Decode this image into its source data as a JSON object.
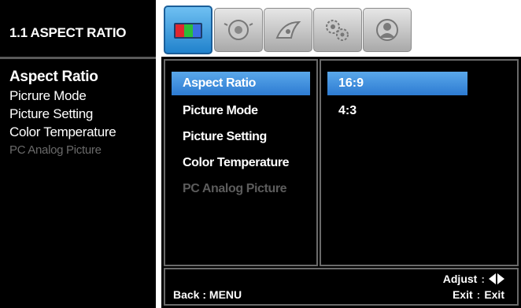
{
  "left_panel": {
    "title": "1.1 ASPECT RATIO",
    "items": [
      {
        "label": "Aspect Ratio",
        "state": "selected"
      },
      {
        "label": "Picrure Mode",
        "state": "normal"
      },
      {
        "label": "Picture Setting",
        "state": "normal"
      },
      {
        "label": "Color Temperature",
        "state": "normal"
      },
      {
        "label": "PC Analog Picture",
        "state": "disabled"
      }
    ]
  },
  "tabs": [
    {
      "icon": "picture-icon",
      "active": true
    },
    {
      "icon": "sound-icon",
      "active": false
    },
    {
      "icon": "function-icon",
      "active": false
    },
    {
      "icon": "setup-icon",
      "active": false
    },
    {
      "icon": "user-icon",
      "active": false
    }
  ],
  "menu": {
    "items": [
      {
        "label": "Aspect Ratio",
        "state": "selected"
      },
      {
        "label": "Picture Mode",
        "state": "normal"
      },
      {
        "label": "Picture Setting",
        "state": "normal"
      },
      {
        "label": "Color Temperature",
        "state": "normal"
      },
      {
        "label": "PC Analog Picture",
        "state": "disabled"
      }
    ]
  },
  "options": {
    "items": [
      {
        "label": "16:9",
        "state": "selected"
      },
      {
        "label": "4:3",
        "state": "normal"
      }
    ]
  },
  "footer": {
    "back_label": "Back : MENU",
    "adjust_label": "Adjust",
    "exit_label": "Exit",
    "exit_value": "Exit"
  },
  "colors": {
    "highlight": "#3f8fde",
    "active_tab": "#3aa0e6",
    "border": "#6a6a6a"
  }
}
